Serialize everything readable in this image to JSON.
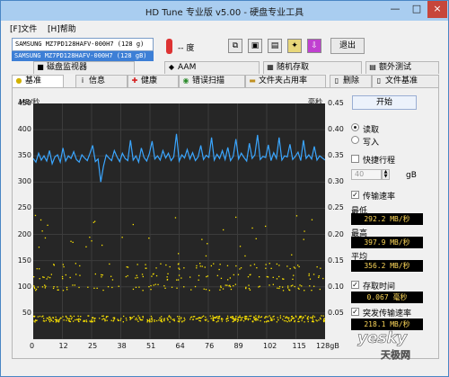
{
  "window": {
    "title": "HD Tune 专业版 v5.00 - 硬盘专业工具",
    "controls": [
      "—",
      "□",
      "×"
    ]
  },
  "menu": {
    "file": "[F]文件",
    "help": "[H]帮助"
  },
  "toolbar": {
    "drive": "SAMSUNG MZ7PD128HAFV-000H7 (128 g)",
    "drive_option": "SAMSUNG MZ7PD128HAFV-000H7 (128 gB)",
    "temperature": "-- 度",
    "exit": "退出"
  },
  "tabs_top": [
    "磁盘监视器",
    "AAM",
    "随机存取",
    "额外测试"
  ],
  "tabs_bottom": [
    "基准",
    "信息",
    "健康",
    "错误扫描",
    "文件夹占用率",
    "删除",
    "文件基准"
  ],
  "chart_data": {
    "type": "scatter",
    "y_left_unit": "MB/秒",
    "y_right_unit": "毫秒",
    "y_left_ticks": [
      "450",
      "400",
      "350",
      "300",
      "250",
      "200",
      "150",
      "100",
      "50"
    ],
    "y_right_ticks": [
      "0.45",
      "0.40",
      "0.35",
      "0.30",
      "0.25",
      "0.20",
      "0.15",
      "0.10",
      "0.05"
    ],
    "x_ticks": [
      "0",
      "12",
      "25",
      "38",
      "51",
      "64",
      "76",
      "89",
      "102",
      "115",
      "128gB"
    ],
    "xlim": [
      0,
      128
    ],
    "ylim": [
      0,
      450
    ],
    "transfer_rate_mb_s": [
      345,
      338,
      355,
      342,
      350,
      340,
      360,
      335,
      348,
      352,
      338,
      365,
      340,
      350,
      345,
      358,
      343,
      338,
      352,
      346,
      341,
      355,
      370,
      339,
      344,
      300,
      330,
      352,
      346,
      341,
      360,
      348,
      339,
      355,
      345,
      341,
      380,
      342,
      350,
      338,
      365,
      347,
      340,
      355,
      378,
      344,
      350,
      342,
      360,
      346,
      355,
      341,
      348,
      392,
      340,
      352,
      346,
      362,
      344,
      356,
      341,
      348,
      370,
      343,
      351,
      347,
      385,
      342,
      353,
      345,
      360,
      343,
      366,
      341,
      349,
      382,
      344,
      355,
      347,
      340,
      374,
      345,
      352,
      390,
      343,
      349,
      347,
      371,
      341,
      356,
      345,
      385,
      342,
      350,
      348,
      372,
      343,
      349,
      357,
      341,
      380,
      345,
      352,
      344,
      368,
      342,
      350,
      346,
      342
    ],
    "access_time_bands_ms": [
      0.04,
      0.1,
      0.12,
      0.14
    ],
    "grid": true
  },
  "side": {
    "start": "开始",
    "read": "读取",
    "write": "写入",
    "short_stroke": "快捷行程",
    "short_stroke_value": "40",
    "short_stroke_unit": "gB",
    "transfer_rate": "传输速率",
    "min_label": "最低",
    "min_value": "292.2 MB/秒",
    "max_label": "最高",
    "max_value": "397.9 MB/秒",
    "avg_label": "平均",
    "avg_value": "356.2 MB/秒",
    "access_time": "存取时间",
    "access_value": "0.067 毫秒",
    "burst_rate": "突发传输速率",
    "burst_value": "218.1 MB/秒"
  },
  "watermark": {
    "text": "yesky",
    "sub": "天极网"
  },
  "colors": {
    "chart_bg": "#262626",
    "line": "#3aa6ff",
    "dots": "#ffe600",
    "value_text": "#ffd95a"
  }
}
